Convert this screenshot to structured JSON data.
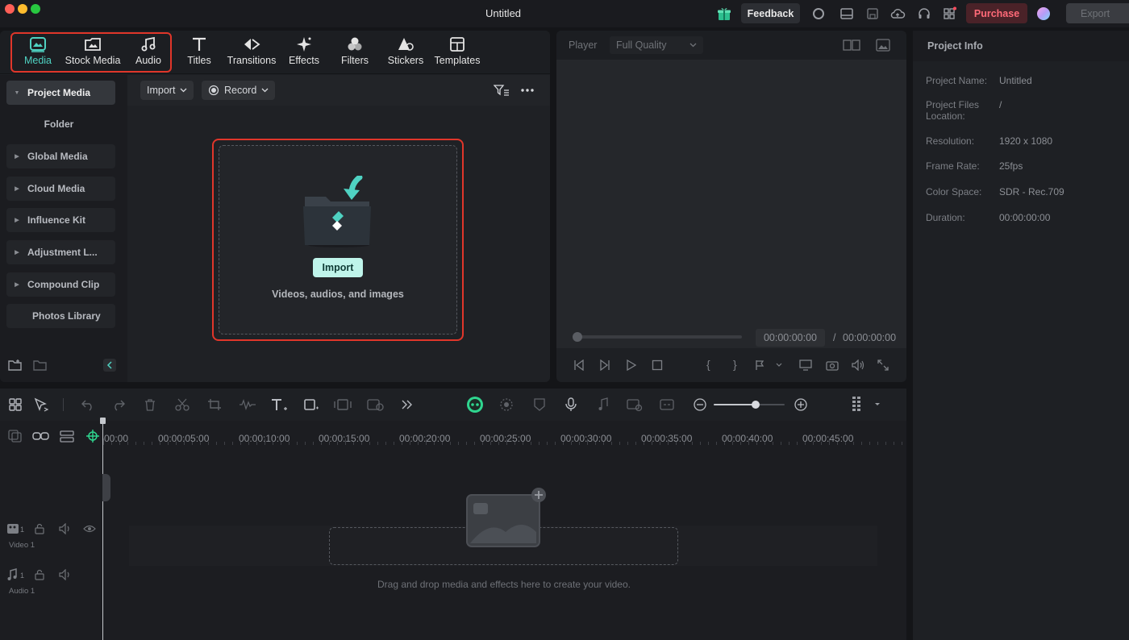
{
  "window": {
    "title": "Untitled"
  },
  "titlebar": {
    "feedback_label": "Feedback",
    "purchase_label": "Purchase",
    "export_label": "Export",
    "accent": "#4fd2c2",
    "purchase_color": "#ff6a78",
    "icons": [
      "gift-icon",
      "circle-icon",
      "layout-icon",
      "save-icon",
      "cloud-icon",
      "headset-icon",
      "grid-icon",
      "avatar"
    ]
  },
  "tabs": [
    {
      "label": "Media",
      "icon": "media-icon",
      "active": true
    },
    {
      "label": "Stock Media",
      "icon": "stock-media-icon"
    },
    {
      "label": "Audio",
      "icon": "music-note-icon"
    },
    {
      "label": "Titles",
      "icon": "text-t-icon"
    },
    {
      "label": "Transitions",
      "icon": "transitions-icon"
    },
    {
      "label": "Effects",
      "icon": "sparkle-icon"
    },
    {
      "label": "Filters",
      "icon": "filters-icon"
    },
    {
      "label": "Stickers",
      "icon": "stickers-icon"
    },
    {
      "label": "Templates",
      "icon": "templates-icon"
    }
  ],
  "sidebar": {
    "items": [
      {
        "label": "Project Media",
        "active": true,
        "caret": true
      },
      {
        "label": "Folder",
        "plain": true
      },
      {
        "label": "Global Media",
        "caret": true
      },
      {
        "label": "Cloud Media",
        "caret": true
      },
      {
        "label": "Influence Kit",
        "caret": true
      },
      {
        "label": "Adjustment L...",
        "caret": true
      },
      {
        "label": "Compound Clip",
        "caret": true
      },
      {
        "label": "Photos Library"
      }
    ]
  },
  "media": {
    "import_dropdown": "Import",
    "record_dropdown": "Record",
    "import_button": "Import",
    "drop_caption": "Videos, audios, and images"
  },
  "player": {
    "label": "Player",
    "quality": "Full Quality",
    "current_time": "00:00:00:00",
    "separator": "/",
    "total_time": "00:00:00:00"
  },
  "project_info": {
    "title": "Project Info",
    "rows": [
      {
        "label": "Project Name:",
        "value": "Untitled"
      },
      {
        "label": "Project Files Location:",
        "value": "/"
      },
      {
        "label": "Resolution:",
        "value": "1920 x 1080"
      },
      {
        "label": "Frame Rate:",
        "value": "25fps"
      },
      {
        "label": "Color Space:",
        "value": "SDR - Rec.709"
      },
      {
        "label": "Duration:",
        "value": "00:00:00:00"
      }
    ]
  },
  "timeline": {
    "ruler": [
      "00:00",
      "00:00:05:00",
      "00:00:10:00",
      "00:00:15:00",
      "00:00:20:00",
      "00:00:25:00",
      "00:00:30:00",
      "00:00:35:00",
      "00:00:40:00",
      "00:00:45:00"
    ],
    "tracks": [
      {
        "name": "Video 1",
        "index": "1"
      },
      {
        "name": "Audio 1",
        "index": "1"
      }
    ],
    "drop_text": "Drag and drop media and effects here to create your video."
  }
}
